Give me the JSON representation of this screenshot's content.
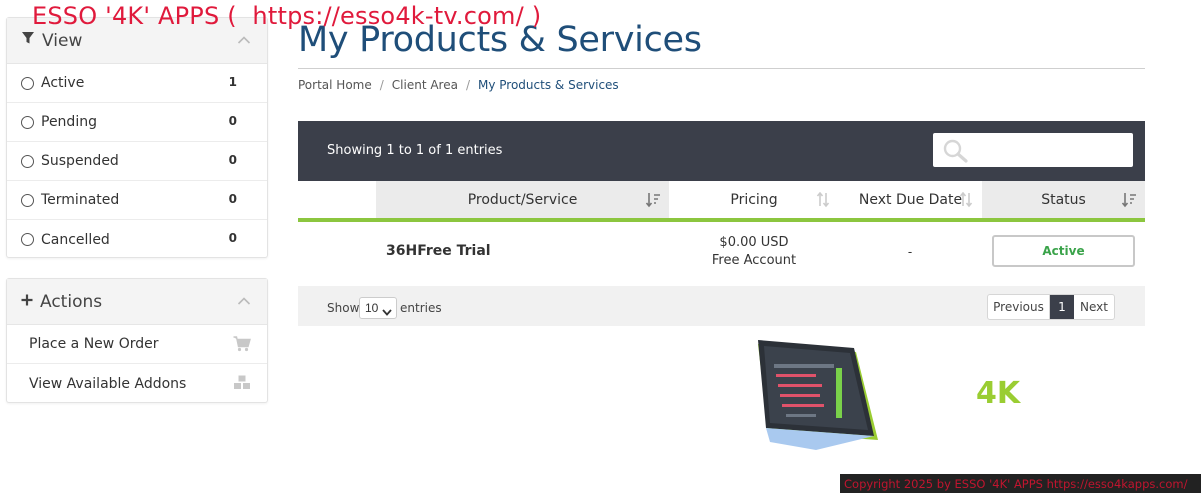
{
  "brand": {
    "banner": "ESSO '4K' APPS (  https://esso4k-tv.com/ )"
  },
  "sidebar": {
    "view": {
      "title": "View",
      "items": [
        {
          "label": "Active",
          "count": "1"
        },
        {
          "label": "Pending",
          "count": "0"
        },
        {
          "label": "Suspended",
          "count": "0"
        },
        {
          "label": "Terminated",
          "count": "0"
        },
        {
          "label": "Cancelled",
          "count": "0"
        }
      ]
    },
    "actions": {
      "title": "Actions",
      "items": [
        {
          "label": "Place a New Order",
          "icon": "cart-icon"
        },
        {
          "label": "View Available Addons",
          "icon": "cubes-icon"
        }
      ]
    }
  },
  "main": {
    "title": "My Products & Services",
    "breadcrumb": [
      "Portal Home",
      "Client Area",
      "My Products & Services"
    ],
    "table": {
      "showing": "Showing 1 to 1 of 1 entries",
      "search_placeholder": "",
      "columns": [
        "Product/Service",
        "Pricing",
        "Next Due Date",
        "Status"
      ],
      "rows": [
        {
          "product": "36HFree Trial",
          "price": "$0.00 USD",
          "price_note": "Free Account",
          "due": "-",
          "status": "Active"
        }
      ],
      "footer": {
        "show_label": "Show",
        "length": "10",
        "entries_label": "entries",
        "previous": "Previous",
        "page": "1",
        "next": "Next"
      }
    },
    "promo": {
      "label": "4K"
    }
  },
  "footer": {
    "copyright": "Copyright 2025  by ESSO '4K' APPS https://esso4kapps.com/"
  },
  "colors": {
    "accent_green": "#8cc63f",
    "title_blue": "#1f4e79",
    "header_dark": "#3b3f4a",
    "brand_red": "#e01a3c"
  }
}
